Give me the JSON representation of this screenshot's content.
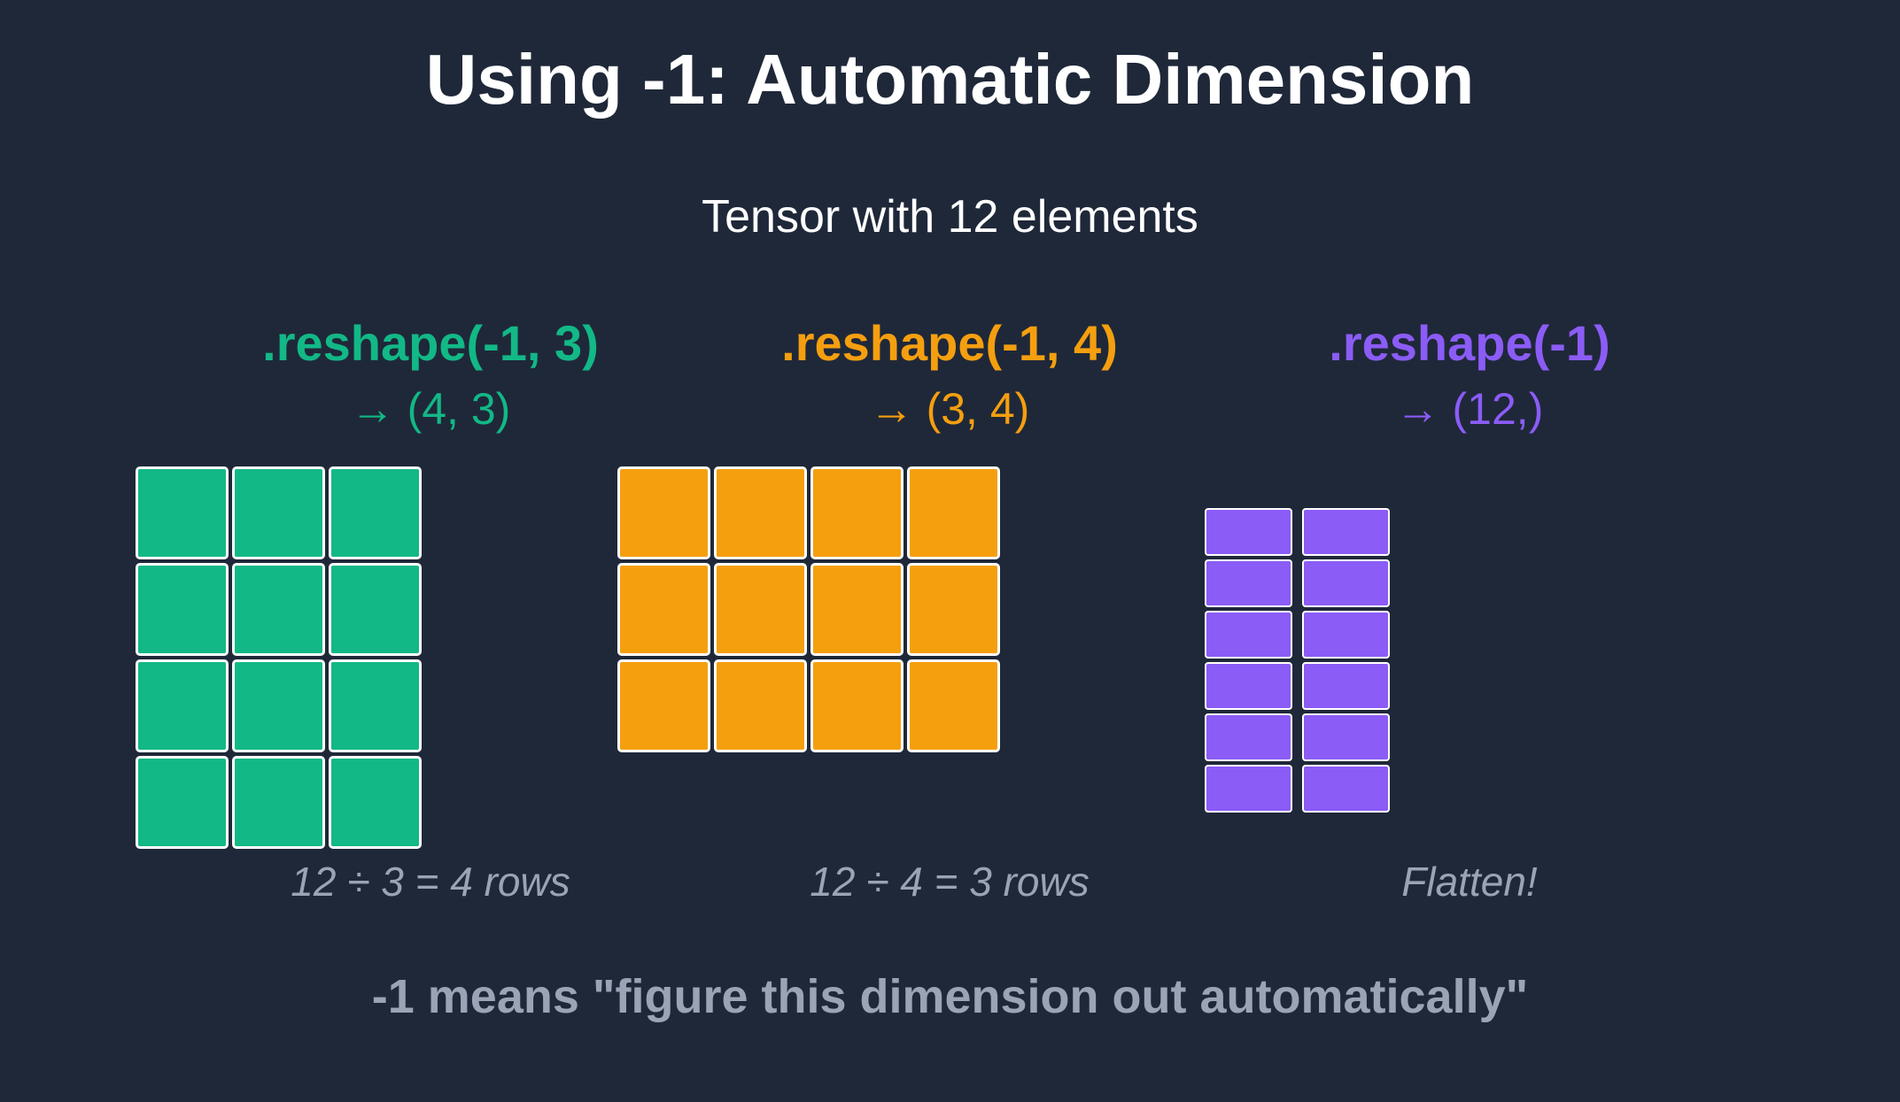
{
  "title": "Using -1: Automatic Dimension",
  "subtitle": "Tensor with 12 elements",
  "columns": [
    {
      "call": ".reshape(-1, 3)",
      "result": "→ (4, 3)",
      "note": "12 ÷ 3 = 4 rows",
      "color": "#12b886",
      "rows": 4,
      "cols": 3
    },
    {
      "call": ".reshape(-1, 4)",
      "result": "→ (3, 4)",
      "note": "12 ÷ 4 = 3 rows",
      "color": "#f59f0f",
      "rows": 3,
      "cols": 4
    },
    {
      "call": ".reshape(-1)",
      "result": "→ (12,)",
      "note": "Flatten!",
      "color": "#8b5cf6",
      "rows": 6,
      "cols": 2
    }
  ],
  "footer": "-1 means \"figure this dimension out automatically\""
}
